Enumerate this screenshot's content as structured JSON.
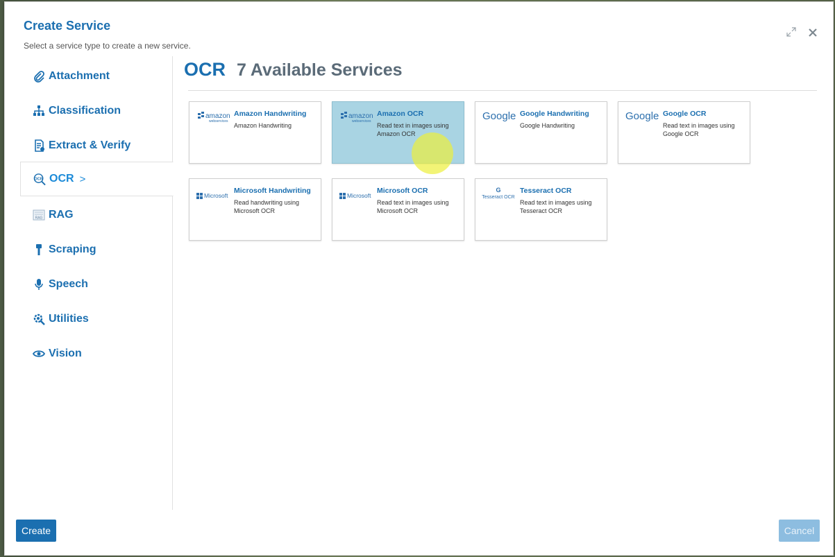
{
  "dialog": {
    "title": "Create Service",
    "subtitle": "Select a service type to create a new service."
  },
  "sidebar": {
    "items": [
      {
        "label": "Attachment",
        "icon": "paperclip-icon"
      },
      {
        "label": "Classification",
        "icon": "hierarchy-icon"
      },
      {
        "label": "Extract & Verify",
        "icon": "document-check-icon"
      },
      {
        "label": "OCR",
        "icon": "ocr-icon",
        "active": true
      },
      {
        "label": "RAG",
        "icon": "rag-icon"
      },
      {
        "label": "Scraping",
        "icon": "brush-icon"
      },
      {
        "label": "Speech",
        "icon": "microphone-icon"
      },
      {
        "label": "Utilities",
        "icon": "gear-wrench-icon"
      },
      {
        "label": "Vision",
        "icon": "eye-icon"
      }
    ],
    "active_chevron": ">"
  },
  "main": {
    "category": "OCR",
    "count_label": "7 Available Services",
    "cards": [
      {
        "name": "Amazon Handwriting",
        "desc": "Amazon Handwriting",
        "logo": "amazon-web-services-logo"
      },
      {
        "name": "Amazon OCR",
        "desc": "Read text in images using Amazon OCR",
        "logo": "amazon-web-services-logo",
        "selected": true
      },
      {
        "name": "Google Handwriting",
        "desc": "Google Handwriting",
        "logo": "google-logo"
      },
      {
        "name": "Google OCR",
        "desc": "Read text in images using Google OCR",
        "logo": "google-logo"
      },
      {
        "name": "Microsoft Handwriting",
        "desc": "Read handwriting using Microsoft OCR",
        "logo": "microsoft-logo"
      },
      {
        "name": "Microsoft OCR",
        "desc": "Read text in images using Microsoft OCR",
        "logo": "microsoft-logo"
      },
      {
        "name": "Tesseract OCR",
        "desc": "Read text in images using Tesseract OCR",
        "logo": "tesseract-logo"
      }
    ]
  },
  "logos": {
    "amazon_word": "amazon",
    "amazon_sub": "webservices",
    "google_word": "Google",
    "microsoft_word": "Microsoft",
    "tesseract_mark": "G",
    "tesseract_word": "Tesseract OCR"
  },
  "footer": {
    "create_label": "Create",
    "cancel_label": "Cancel"
  },
  "colors": {
    "brand": "#1b6fb0",
    "selected_card": "#a9d4e3",
    "cursor_highlight": "#ecf03c"
  }
}
